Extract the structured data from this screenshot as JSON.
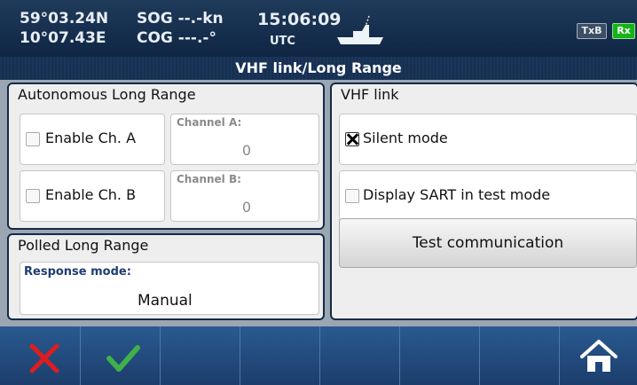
{
  "status": {
    "latitude": "59°03.24N",
    "longitude": "10°07.43E",
    "sog": "SOG --.-kn",
    "cog": "COG ---.-°",
    "time": "15:06:09",
    "time_zone": "UTC",
    "ship_icon": "ship-icon",
    "txb_label": "TxB",
    "rx_label": "Rx"
  },
  "title": "VHF link/Long Range",
  "autonomous": {
    "title": "Autonomous Long Range",
    "enable_a_label": "Enable Ch. A",
    "enable_a_checked": false,
    "enable_b_label": "Enable Ch. B",
    "enable_b_checked": false,
    "channel_a_label": "Channel A:",
    "channel_a_value": "0",
    "channel_b_label": "Channel B:",
    "channel_b_value": "0"
  },
  "polled": {
    "title": "Polled Long Range",
    "response_label": "Response mode:",
    "response_value": "Manual"
  },
  "vhf": {
    "title": "VHF link",
    "silent_label": "Silent mode",
    "silent_checked": true,
    "sart_label": "Display SART in test mode",
    "sart_checked": false,
    "test_button_label": "Test communication"
  },
  "toolbar": {
    "cancel_icon": "close-icon",
    "ok_icon": "checkmark-icon",
    "home_icon": "home-icon"
  },
  "colors": {
    "accent_navy": "#152a46",
    "rx_green": "#16b21a",
    "cancel_red": "#e01c1c",
    "ok_green": "#3fb04a"
  }
}
